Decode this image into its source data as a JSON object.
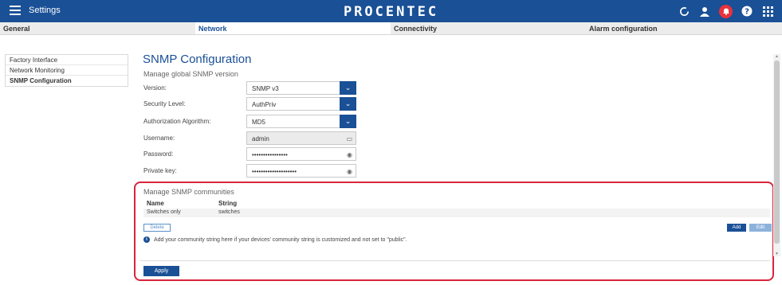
{
  "topbar": {
    "title": "Settings",
    "brand": "PROCENTEC",
    "icons": [
      "refresh-icon",
      "user-icon",
      "alarm-bell-icon",
      "help-icon",
      "apps-grid-icon"
    ],
    "colors": {
      "bar": "#1a5096",
      "alarm": "#e8323c",
      "highlight": "#d9243d"
    }
  },
  "tabs": [
    {
      "label": "General",
      "active": false
    },
    {
      "label": "Network",
      "active": true
    },
    {
      "label": "Connectivity",
      "active": false
    },
    {
      "label": "Alarm configuration",
      "active": false
    }
  ],
  "side_menu": [
    {
      "label": "Factory Interface",
      "selected": false
    },
    {
      "label": "Network Monitoring",
      "selected": false
    },
    {
      "label": "SNMP Configuration",
      "selected": true
    }
  ],
  "page": {
    "title": "SNMP Configuration",
    "subtitle": "Manage global SNMP version"
  },
  "form": {
    "version": {
      "label": "Version:",
      "value": "SNMP v3"
    },
    "security_level": {
      "label": "Security Level:",
      "value": "AuthPriv"
    },
    "auth_algorithm": {
      "label": "Authorization Algorithm:",
      "value": "MD5"
    },
    "username": {
      "label": "Username:",
      "value": "admin"
    },
    "password": {
      "label": "Password:",
      "value": "••••••••••••••••"
    },
    "private_key": {
      "label": "Private key:",
      "value": "••••••••••••••••••••"
    }
  },
  "communities": {
    "title": "Manage SNMP communities",
    "columns": [
      "Name",
      "String"
    ],
    "rows": [
      [
        "Switches only",
        "switches"
      ]
    ],
    "delete_label": "Delete",
    "add_label": "Add",
    "edit_label": "Edit",
    "info_text": "Add your community string here if your devices' community string is customized and not set to \"public\".",
    "apply_label": "Apply"
  }
}
